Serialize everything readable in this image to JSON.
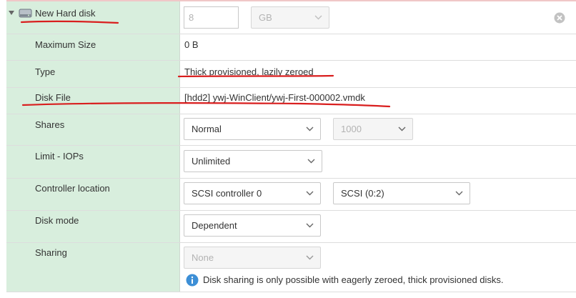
{
  "header": {
    "title": "New Hard disk",
    "size_value": "8",
    "size_unit": "GB"
  },
  "rows": {
    "max_size": {
      "label": "Maximum Size",
      "value": "0 B"
    },
    "type": {
      "label": "Type",
      "value": "Thick provisioned, lazily zeroed"
    },
    "disk_file": {
      "label": "Disk File",
      "value": "[hdd2] ywj-WinClient/ywj-First-000002.vmdk"
    },
    "shares": {
      "label": "Shares",
      "select": "Normal",
      "number": "1000"
    },
    "limit": {
      "label": "Limit - IOPs",
      "select": "Unlimited"
    },
    "controller": {
      "label": "Controller location",
      "controller": "SCSI controller 0",
      "slot": "SCSI (0:2)"
    },
    "disk_mode": {
      "label": "Disk mode",
      "select": "Dependent"
    },
    "sharing": {
      "label": "Sharing",
      "select": "None",
      "info": "Disk sharing is only possible with eagerly zeroed, thick provisioned disks."
    }
  },
  "colors": {
    "label_column": "#d8eedd",
    "annotation": "#d91e1e",
    "info_icon": "#3d8fd6"
  },
  "icons": [
    "expand-caret-icon",
    "hard-disk-icon",
    "remove-icon",
    "chevron-down-icon",
    "info-icon"
  ]
}
